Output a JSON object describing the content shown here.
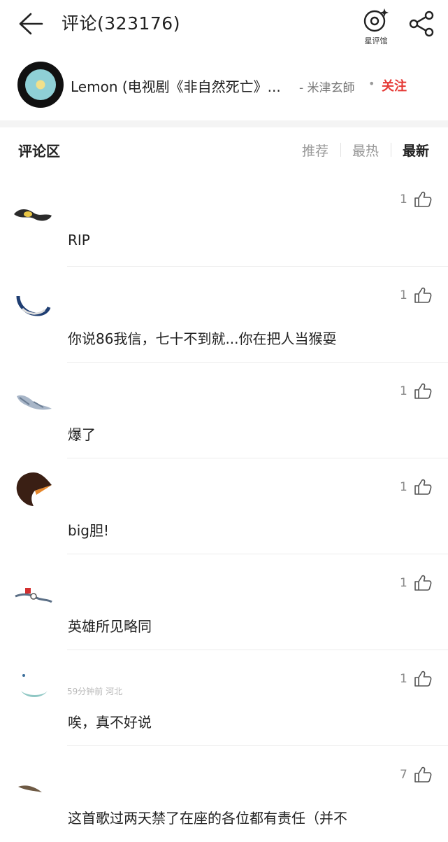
{
  "header": {
    "title": "评论(323176)",
    "star_label": "星评馆"
  },
  "song": {
    "title": "Lemon (电视剧《非自然死亡》...",
    "artist": "- 米津玄師",
    "dot": "•",
    "follow": "关注"
  },
  "section": {
    "title": "评论区",
    "sort": [
      "推荐",
      "最热",
      "最新"
    ],
    "active_sort": "最新"
  },
  "comments": [
    {
      "meta": "",
      "text": "RIP",
      "likes": "1"
    },
    {
      "meta": "",
      "text": "你说86我信，七十不到就...你在把人当猴耍",
      "likes": "1"
    },
    {
      "meta": "",
      "text": "爆了",
      "likes": "1"
    },
    {
      "meta": "",
      "text": "big胆!",
      "likes": "1"
    },
    {
      "meta": "",
      "text": "英雄所见略同",
      "likes": "1"
    },
    {
      "meta": "59分钟前 河北",
      "text": "唉，真不好说",
      "likes": "1"
    },
    {
      "meta": "",
      "text": "这首歌过两天禁了在座的各位都有责任（并不",
      "likes": "7"
    }
  ],
  "colors": {
    "follow": "#e53935",
    "active_sort": "#222222",
    "inactive_sort": "#999999"
  }
}
